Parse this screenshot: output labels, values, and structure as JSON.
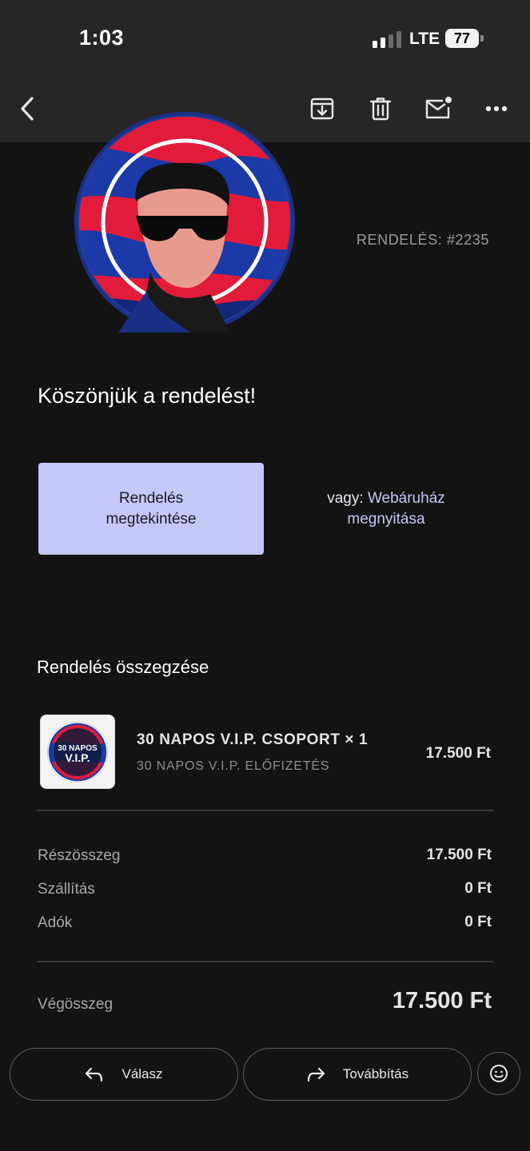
{
  "status_bar": {
    "time": "1:03",
    "network": "LTE",
    "battery": "77"
  },
  "toolbar": {
    "icons": [
      "back-icon",
      "archive-icon",
      "trash-icon",
      "mark-unread-icon",
      "more-icon"
    ]
  },
  "email": {
    "order_number": "RENDELÉS: #2235",
    "thanks_heading": "Köszönjük a rendelést!",
    "view_order_line1": "Rendelés",
    "view_order_line2": "megtekintése",
    "or_prefix": "vagy:",
    "open_store_line1": "Webáruház",
    "open_store_line2": "megnyitása",
    "summary_title": "Rendelés összegzése",
    "item": {
      "name": "30 NAPOS V.I.P. CSOPORT × 1",
      "variant": "30 NAPOS V.I.P. ELŐFIZETÉS",
      "price": "17.500 Ft",
      "thumb_line1": "30 NAPOS",
      "thumb_line2": "V.I.P."
    },
    "subtotal_label": "Részösszeg",
    "subtotal_value": "17.500 Ft",
    "shipping_label": "Szállítás",
    "shipping_value": "0 Ft",
    "taxes_label": "Adók",
    "taxes_value": "0 Ft",
    "total_label": "Végösszeg",
    "total_value": "17.500 Ft"
  },
  "actions": {
    "reply_label": "Válasz",
    "forward_label": "Továbbítás"
  },
  "colors": {
    "background": "#131313",
    "bar": "#262626",
    "accent_button": "#c3c8f8",
    "muted_text": "#9a9a9a"
  }
}
